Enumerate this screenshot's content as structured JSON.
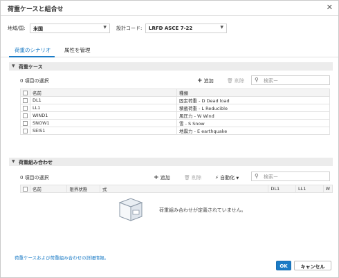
{
  "dialog": {
    "title": "荷重ケースと組合せ",
    "close_glyph": "✕"
  },
  "top": {
    "region_label": "地域/国:",
    "region_value": "米国",
    "design_code_label": "設計コード:",
    "design_code_value": "LRFD ASCE 7-22",
    "dropdown_glyph": "▼"
  },
  "tabs": [
    "荷重のシナリオ",
    "属性を管理"
  ],
  "load_cases": {
    "title": "荷重ケース",
    "selected_count": "0 項目の選択",
    "add_label": "追加",
    "delete_label": "削除",
    "search_placeholder": "検索ー",
    "columns": [
      "名前",
      "種類"
    ],
    "rows": [
      [
        "DL1",
        "固定荷重 - D Dead load"
      ],
      [
        "LL1",
        "積載荷重 - L Reducible"
      ],
      [
        "WIND1",
        "風圧力 - W Wind"
      ],
      [
        "SNOW1",
        "雪 - S Snow"
      ],
      [
        "SEIS1",
        "地震力 - E earthquake"
      ]
    ]
  },
  "load_combos": {
    "title": "荷重組み合わせ",
    "selected_count": "0 項目の選択",
    "add_label": "追加",
    "delete_label": "削除",
    "automate_label": "自動化",
    "search_placeholder": "検索ー",
    "columns": [
      "名前",
      "限界状態",
      "式",
      "DL1",
      "LL1",
      "W"
    ],
    "empty_message": "荷重組み合わせが定義されていません。"
  },
  "footer": {
    "info_link": "荷重ケースおよび荷重組み合わせの詳細情報。",
    "ok_label": "OK",
    "cancel_label": "キャンセル"
  },
  "colors": {
    "accent": "#1a7bc6",
    "section_bg": "#ececec"
  },
  "icons": [
    "close-icon",
    "chevron-down-icon",
    "plus-icon",
    "trash-icon",
    "search-icon",
    "lightning-icon",
    "empty-box-icon"
  ]
}
